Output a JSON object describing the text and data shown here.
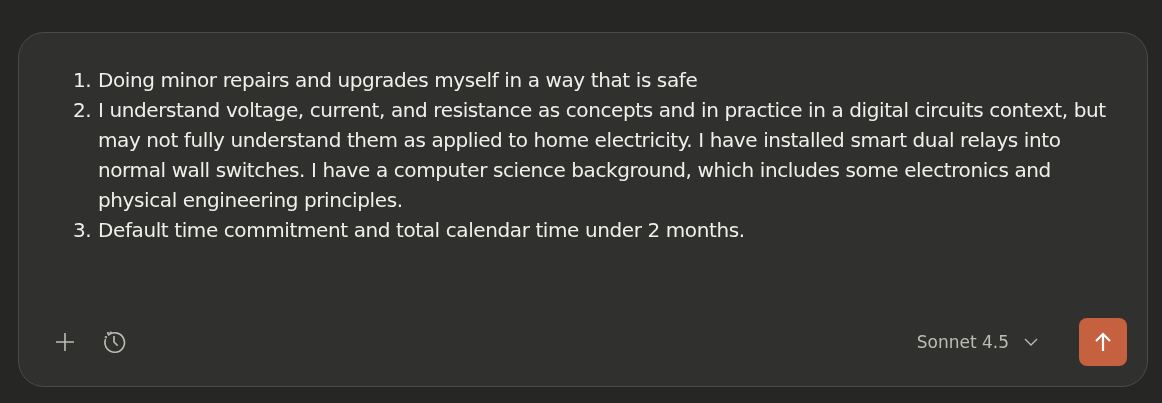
{
  "message": {
    "items": [
      {
        "number": "1.",
        "text": "Doing minor repairs and upgrades myself in a way that is safe"
      },
      {
        "number": "2.",
        "text": "I understand voltage, current, and resistance as concepts and in practice in a digital circuits context, but may not fully understand them as applied to home electricity. I have installed smart dual relays into normal wall switches. I have a computer science background, which includes some electronics and physical engineering principles."
      },
      {
        "number": "3.",
        "text": "Default time commitment and total calendar time under 2 months."
      }
    ]
  },
  "toolbar": {
    "model": "Sonnet 4.5"
  }
}
